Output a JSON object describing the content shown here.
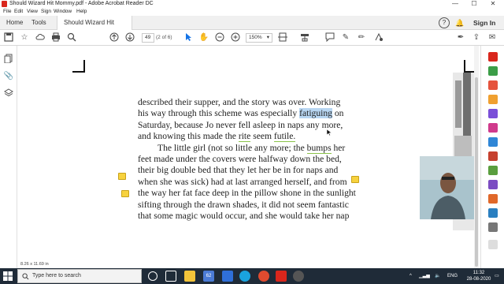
{
  "window": {
    "title": "Should Wizard Hit Mommy.pdf - Adobe Acrobat Reader DC",
    "minimize_glyph": "—",
    "maximize_glyph": "☐",
    "close_glyph": "✕"
  },
  "menu": [
    "File",
    "Edit",
    "View",
    "Sign",
    "Window",
    "Help"
  ],
  "tabs": {
    "home": "Home",
    "tools": "Tools",
    "document": "Should Wizard Hit ...",
    "close_glyph": "✕",
    "help_glyph": "?",
    "bell_glyph": "🔔",
    "sign_in": "Sign In"
  },
  "toolbar": {
    "page_current": "49",
    "page_info": "(2 of 6)",
    "zoom": "150%",
    "zoom_arrow": "▾"
  },
  "document": {
    "line1": "described their supper, and the story was over. Working",
    "line2a": "his way through this scheme was especially ",
    "line2_highlight": "fatiguing",
    "line2b": " on",
    "line3": "Saturday, because Jo never fell asleep in naps any more,",
    "line4a": "and knowing this made the ",
    "line4_rite": "rite",
    "line4b": " seem ",
    "line4_futile": "futile.",
    "para2_line1a": "The little girl (not so little any more; the ",
    "para2_bumps": "bumps",
    "para2_line1b": " her",
    "para2_line2": "feet made under the covers were halfway down the bed,",
    "para2_line3": "their big double bed that they let her be in for naps and",
    "para2_line4": "when she was sick) had at last arranged herself, and from",
    "para2_line5": "the way her fat face deep in the pillow shone in the sunlight",
    "para2_line6": "sifting through the drawn shades, it did not seem fantastic",
    "para2_line7": "that some magic would occur, and she would take her nap",
    "page_size": "8.26 x 11.69 in"
  },
  "taskbar": {
    "search_placeholder": "Type here to search",
    "badge": "62",
    "time": "11:32",
    "date": "28-08-2020",
    "lang": "ENG",
    "tray_arrow": "^"
  },
  "colors": {
    "highlight": "#b8d6f2",
    "note": "#f7d23e",
    "accent": "#1473e6",
    "taskbar": "#1f2b38"
  }
}
